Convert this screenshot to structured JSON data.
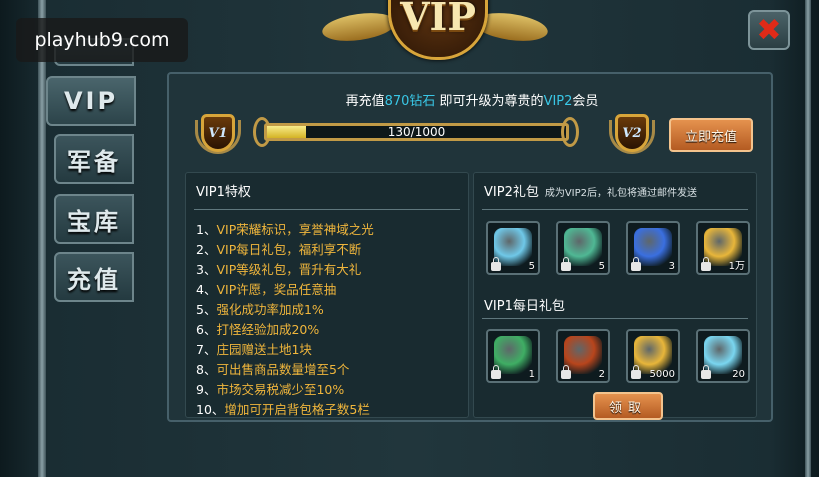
{
  "watermark": "playhub9.com",
  "crest": {
    "label": "VIP"
  },
  "close": {
    "icon": "close-icon",
    "glyph": "✖"
  },
  "tabs": [
    {
      "label": "",
      "id": "top"
    },
    {
      "label": "VIP",
      "id": "vip",
      "active": true
    },
    {
      "label": "军备",
      "id": "armory"
    },
    {
      "label": "宝库",
      "id": "treasury"
    },
    {
      "label": "充值",
      "id": "recharge"
    }
  ],
  "upgrade": {
    "prefix": "再充值",
    "amount": "870钻石",
    "middle": " 即可升级为尊贵的",
    "target": "VIP2",
    "suffix": "会员"
  },
  "level": {
    "current": "V1",
    "next": "V2"
  },
  "progress": {
    "text": "130/1000",
    "fraction": 0.13
  },
  "recharge_button": "立即充值",
  "privileges": {
    "title": "VIP1特权",
    "items": [
      {
        "num": "1、",
        "highlight": "VIP",
        "rest": "荣耀标识，享誉神域之光"
      },
      {
        "num": "2、",
        "highlight": "VIP",
        "rest": "每日礼包，福利享不断"
      },
      {
        "num": "3、",
        "highlight": "VIP",
        "rest": "等级礼包，晋升有大礼"
      },
      {
        "num": "4、",
        "highlight": "VIP",
        "rest": "许愿，奖品任意抽"
      },
      {
        "num": "5、",
        "highlight": "",
        "rest": "强化成功率加成1%"
      },
      {
        "num": "6、",
        "highlight": "",
        "rest": "打怪经验加成20%"
      },
      {
        "num": "7、",
        "highlight": "",
        "rest": "庄园赠送土地1块"
      },
      {
        "num": "8、",
        "highlight": "",
        "rest": "可出售商品数量增至5个"
      },
      {
        "num": "9、",
        "highlight": "",
        "rest": "市场交易税减少至10%"
      },
      {
        "num": "10、",
        "highlight": "",
        "rest": "增加可开启背包格子数5栏"
      }
    ]
  },
  "vip2_gift": {
    "title": "VIP2礼包",
    "note": "成为VIP2后，礼包将通过邮件发送",
    "items": [
      {
        "icon": "blue-crystal-icon",
        "qty": "5",
        "color": "#6fc8e8"
      },
      {
        "icon": "green-rune-icon",
        "qty": "5",
        "color": "#4fb894"
      },
      {
        "icon": "blue-star-gem-icon",
        "qty": "3",
        "color": "#3a6fe0"
      },
      {
        "icon": "gold-coins-icon",
        "qty": "1万",
        "color": "#e8b63a"
      }
    ]
  },
  "vip1_daily": {
    "title": "VIP1每日礼包",
    "items": [
      {
        "icon": "reward-scroll-icon",
        "qty": "1",
        "color": "#3fae64"
      },
      {
        "icon": "vip-emblem-icon",
        "qty": "2",
        "color": "#b8451c"
      },
      {
        "icon": "gold-coins-icon",
        "qty": "5000",
        "color": "#e8b63a"
      },
      {
        "icon": "diamond-pile-icon",
        "qty": "20",
        "color": "#7ad6f0"
      }
    ]
  },
  "claim_button": "领取"
}
